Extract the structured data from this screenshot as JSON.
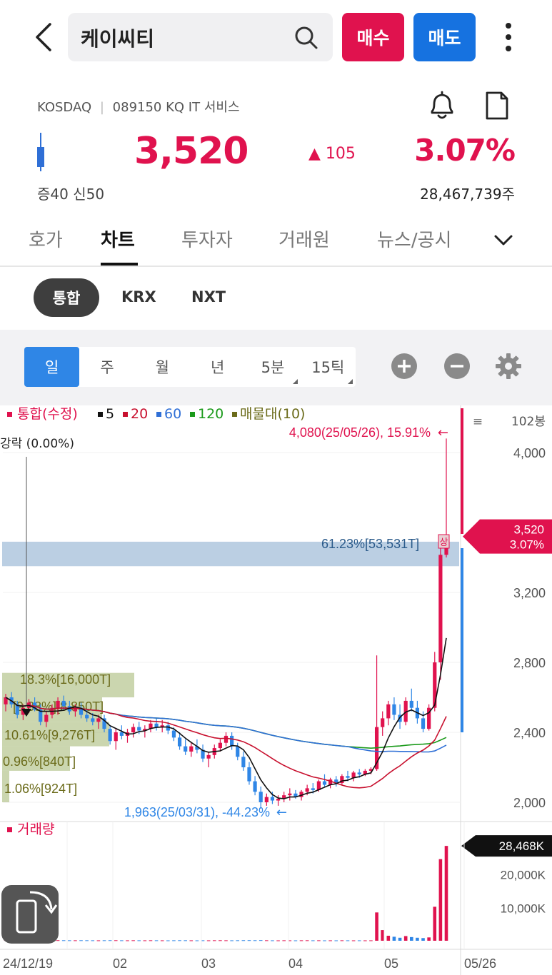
{
  "header": {
    "search_text": "케이씨티",
    "buy_label": "매수",
    "sell_label": "매도"
  },
  "stock": {
    "market": "KOSDAQ",
    "code_line": "089150 KQ IT 서비스",
    "price": "3,520",
    "change": "▲ 105",
    "change_pct": "3.07%",
    "margin": "증40  신50",
    "volume": "28,467,739주"
  },
  "tabs": [
    "호가",
    "차트",
    "투자자",
    "거래원",
    "뉴스/공시"
  ],
  "active_tab": "차트",
  "markets": [
    "통합",
    "KRX",
    "NXT"
  ],
  "periods": [
    "일",
    "주",
    "월",
    "년",
    "5분",
    "15틱"
  ],
  "active_period": "일",
  "chart_data": {
    "type": "candlestick",
    "legend": {
      "main": "통합(수정)",
      "ma": [
        {
          "name": "5",
          "color": "#111111"
        },
        {
          "name": "20",
          "color": "#c8102e"
        },
        {
          "name": "60",
          "color": "#2f6fd6"
        },
        {
          "name": "120",
          "color": "#1a9a1a"
        },
        {
          "name": "매물대(10)",
          "color": "#6b6b1a"
        }
      ]
    },
    "bar_count": "102봉",
    "y_ticks": [
      {
        "value": 4000,
        "label": "4,000"
      },
      {
        "value": 3200,
        "label": "3,200"
      },
      {
        "value": 2800,
        "label": "2,800"
      },
      {
        "value": 2400,
        "label": "2,400"
      },
      {
        "value": 2000,
        "label": "2,000"
      }
    ],
    "x_ticks": [
      "24/12/19",
      "02",
      "03",
      "04",
      "05",
      "05/26"
    ],
    "high_annotation": "4,080(25/05/26), 15.91%",
    "low_annotation": "1,963(25/03/31), -44.23%",
    "current_price_label": "3,520",
    "current_pct_label": "3.07%",
    "upper_limit_mark": "상",
    "crosshair_label": "강락 (0.00%)",
    "volume_profile": [
      {
        "label": "61.23%[53,531T]",
        "price_low": 3350,
        "price_high": 3490
      },
      {
        "label": "18.3%[16,000T]",
        "price_low": 2600,
        "price_high": 2740
      },
      {
        "label": "[9.88%][8,850T]",
        "price_low": 2460,
        "price_high": 2600
      },
      {
        "label": "10.61%[9,276T]",
        "price_low": 2320,
        "price_high": 2460
      },
      {
        "label": "0.96%[840T]",
        "price_low": 2180,
        "price_high": 2320
      },
      {
        "label": "1.06%[924T]",
        "price_low": 2000,
        "price_high": 2180
      }
    ],
    "volume_title": "거래량",
    "volume_ticks": [
      {
        "value": 20000,
        "label": "20,000K"
      },
      {
        "value": 10000,
        "label": "10,000K"
      }
    ],
    "volume_current_label": "28,468K",
    "ylim": [
      1900,
      4200
    ],
    "candles": [
      [
        2560,
        2620,
        2520,
        2600
      ],
      [
        2600,
        2630,
        2540,
        2560
      ],
      [
        2560,
        2580,
        2480,
        2500
      ],
      [
        2500,
        2560,
        2470,
        2540
      ],
      [
        2540,
        2590,
        2510,
        2570
      ],
      [
        2570,
        2600,
        2520,
        2530
      ],
      [
        2530,
        2560,
        2440,
        2460
      ],
      [
        2460,
        2520,
        2430,
        2500
      ],
      [
        2500,
        2560,
        2480,
        2540
      ],
      [
        2540,
        2600,
        2500,
        2580
      ],
      [
        2580,
        2610,
        2530,
        2550
      ],
      [
        2550,
        2580,
        2500,
        2520
      ],
      [
        2520,
        2560,
        2490,
        2540
      ],
      [
        2540,
        2570,
        2480,
        2500
      ],
      [
        2500,
        2530,
        2460,
        2480
      ],
      [
        2480,
        2510,
        2440,
        2460
      ],
      [
        2460,
        2500,
        2420,
        2480
      ],
      [
        2480,
        2500,
        2400,
        2420
      ],
      [
        2420,
        2440,
        2330,
        2350
      ],
      [
        2350,
        2420,
        2300,
        2400
      ],
      [
        2400,
        2440,
        2360,
        2380
      ],
      [
        2380,
        2420,
        2340,
        2400
      ],
      [
        2400,
        2450,
        2370,
        2430
      ],
      [
        2430,
        2460,
        2390,
        2410
      ],
      [
        2410,
        2440,
        2370,
        2420
      ],
      [
        2420,
        2470,
        2400,
        2450
      ],
      [
        2450,
        2480,
        2410,
        2430
      ],
      [
        2430,
        2470,
        2400,
        2440
      ],
      [
        2440,
        2460,
        2390,
        2410
      ],
      [
        2410,
        2430,
        2350,
        2370
      ],
      [
        2370,
        2400,
        2300,
        2320
      ],
      [
        2320,
        2360,
        2270,
        2290
      ],
      [
        2290,
        2340,
        2260,
        2320
      ],
      [
        2320,
        2360,
        2280,
        2300
      ],
      [
        2300,
        2330,
        2230,
        2250
      ],
      [
        2250,
        2290,
        2200,
        2270
      ],
      [
        2270,
        2330,
        2250,
        2310
      ],
      [
        2310,
        2360,
        2290,
        2340
      ],
      [
        2340,
        2400,
        2320,
        2380
      ],
      [
        2380,
        2400,
        2300,
        2320
      ],
      [
        2320,
        2340,
        2240,
        2260
      ],
      [
        2260,
        2290,
        2180,
        2200
      ],
      [
        2200,
        2230,
        2100,
        2120
      ],
      [
        2120,
        2150,
        2040,
        2060
      ],
      [
        2060,
        2090,
        1963,
        2000
      ],
      [
        2000,
        2050,
        1980,
        2030
      ],
      [
        2030,
        2060,
        1990,
        2010
      ],
      [
        2010,
        2040,
        1980,
        2020
      ],
      [
        2020,
        2060,
        2000,
        2040
      ],
      [
        2040,
        2080,
        2010,
        2050
      ],
      [
        2050,
        2070,
        2020,
        2030
      ],
      [
        2030,
        2070,
        2010,
        2060
      ],
      [
        2060,
        2100,
        2040,
        2080
      ],
      [
        2080,
        2110,
        2050,
        2070
      ],
      [
        2070,
        2130,
        2060,
        2120
      ],
      [
        2120,
        2160,
        2090,
        2100
      ],
      [
        2100,
        2140,
        2080,
        2130
      ],
      [
        2130,
        2150,
        2090,
        2110
      ],
      [
        2110,
        2160,
        2100,
        2150
      ],
      [
        2150,
        2180,
        2120,
        2140
      ],
      [
        2140,
        2180,
        2120,
        2170
      ],
      [
        2170,
        2190,
        2140,
        2160
      ],
      [
        2160,
        2190,
        2150,
        2180
      ],
      [
        2180,
        2200,
        2160,
        2190
      ],
      [
        2190,
        2840,
        2180,
        2430
      ],
      [
        2430,
        2520,
        2380,
        2480
      ],
      [
        2480,
        2580,
        2440,
        2560
      ],
      [
        2560,
        2600,
        2470,
        2500
      ],
      [
        2500,
        2560,
        2420,
        2460
      ],
      [
        2460,
        2600,
        2440,
        2580
      ],
      [
        2580,
        2650,
        2520,
        2540
      ],
      [
        2540,
        2580,
        2450,
        2480
      ],
      [
        2480,
        2520,
        2400,
        2420
      ],
      [
        2420,
        2560,
        2410,
        2540
      ],
      [
        2540,
        2860,
        2520,
        2800
      ],
      [
        2800,
        3500,
        2700,
        3415
      ],
      [
        3415,
        4080,
        3400,
        3520
      ]
    ],
    "volumes": [
      200,
      180,
      160,
      150,
      170,
      160,
      140,
      150,
      160,
      170,
      150,
      140,
      130,
      150,
      140,
      130,
      120,
      140,
      160,
      150,
      130,
      120,
      140,
      130,
      120,
      140,
      130,
      120,
      110,
      130,
      150,
      140,
      120,
      110,
      130,
      120,
      140,
      150,
      130,
      120,
      140,
      160,
      170,
      150,
      180,
      140,
      120,
      110,
      130,
      120,
      110,
      130,
      140,
      120,
      130,
      110,
      120,
      110,
      130,
      120,
      110,
      120,
      110,
      120,
      8500,
      3200,
      1500,
      1200,
      900,
      1400,
      1100,
      900,
      800,
      1000,
      10200,
      24500,
      28468
    ]
  }
}
